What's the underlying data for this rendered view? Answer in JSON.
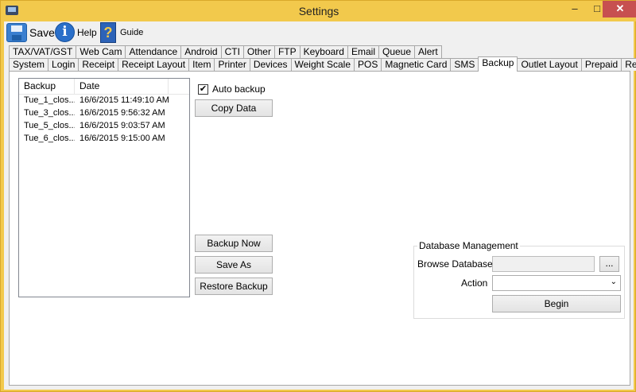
{
  "window": {
    "title": "Settings",
    "controls": {
      "minimize": "–",
      "maximize": "□",
      "close": "✕"
    }
  },
  "toolbar": {
    "save_label": "Save",
    "help_label": "Help",
    "guide_label": "Guide",
    "guide_glyph": "?",
    "help_glyph": "i"
  },
  "tabs": {
    "row1": [
      "TAX/VAT/GST",
      "Web Cam",
      "Attendance",
      "Android",
      "CTI",
      "Other",
      "FTP",
      "Keyboard",
      "Email",
      "Queue",
      "Alert"
    ],
    "row2": [
      "System",
      "Login",
      "Receipt",
      "Receipt Layout",
      "Item",
      "Printer",
      "Devices",
      "Weight Scale",
      "POS",
      "Magnetic Card",
      "SMS",
      "Backup",
      "Outlet Layout",
      "Prepaid",
      "Rewards"
    ],
    "active": "Backup"
  },
  "backup_list": {
    "columns": [
      "Backup",
      "Date"
    ],
    "rows": [
      [
        "Tue_1_clos...",
        "16/6/2015 11:49:10 AM"
      ],
      [
        "Tue_3_clos...",
        "16/6/2015 9:56:32 AM"
      ],
      [
        "Tue_5_clos...",
        "16/6/2015 9:03:57 AM"
      ],
      [
        "Tue_6_clos...",
        "16/6/2015 9:15:00 AM"
      ]
    ]
  },
  "auto_backup": {
    "label": "Auto backup",
    "checked": true,
    "mark": "✔"
  },
  "buttons": {
    "copy_data": "Copy Data",
    "backup_now": "Backup Now",
    "save_as": "Save As",
    "restore_backup": "Restore Backup"
  },
  "database_management": {
    "title": "Database Management",
    "browse_label": "Browse Database",
    "browse_value": "",
    "browse_button": "...",
    "action_label": "Action",
    "action_value": "",
    "begin_button": "Begin",
    "dropdown_arrow": "⌄"
  }
}
